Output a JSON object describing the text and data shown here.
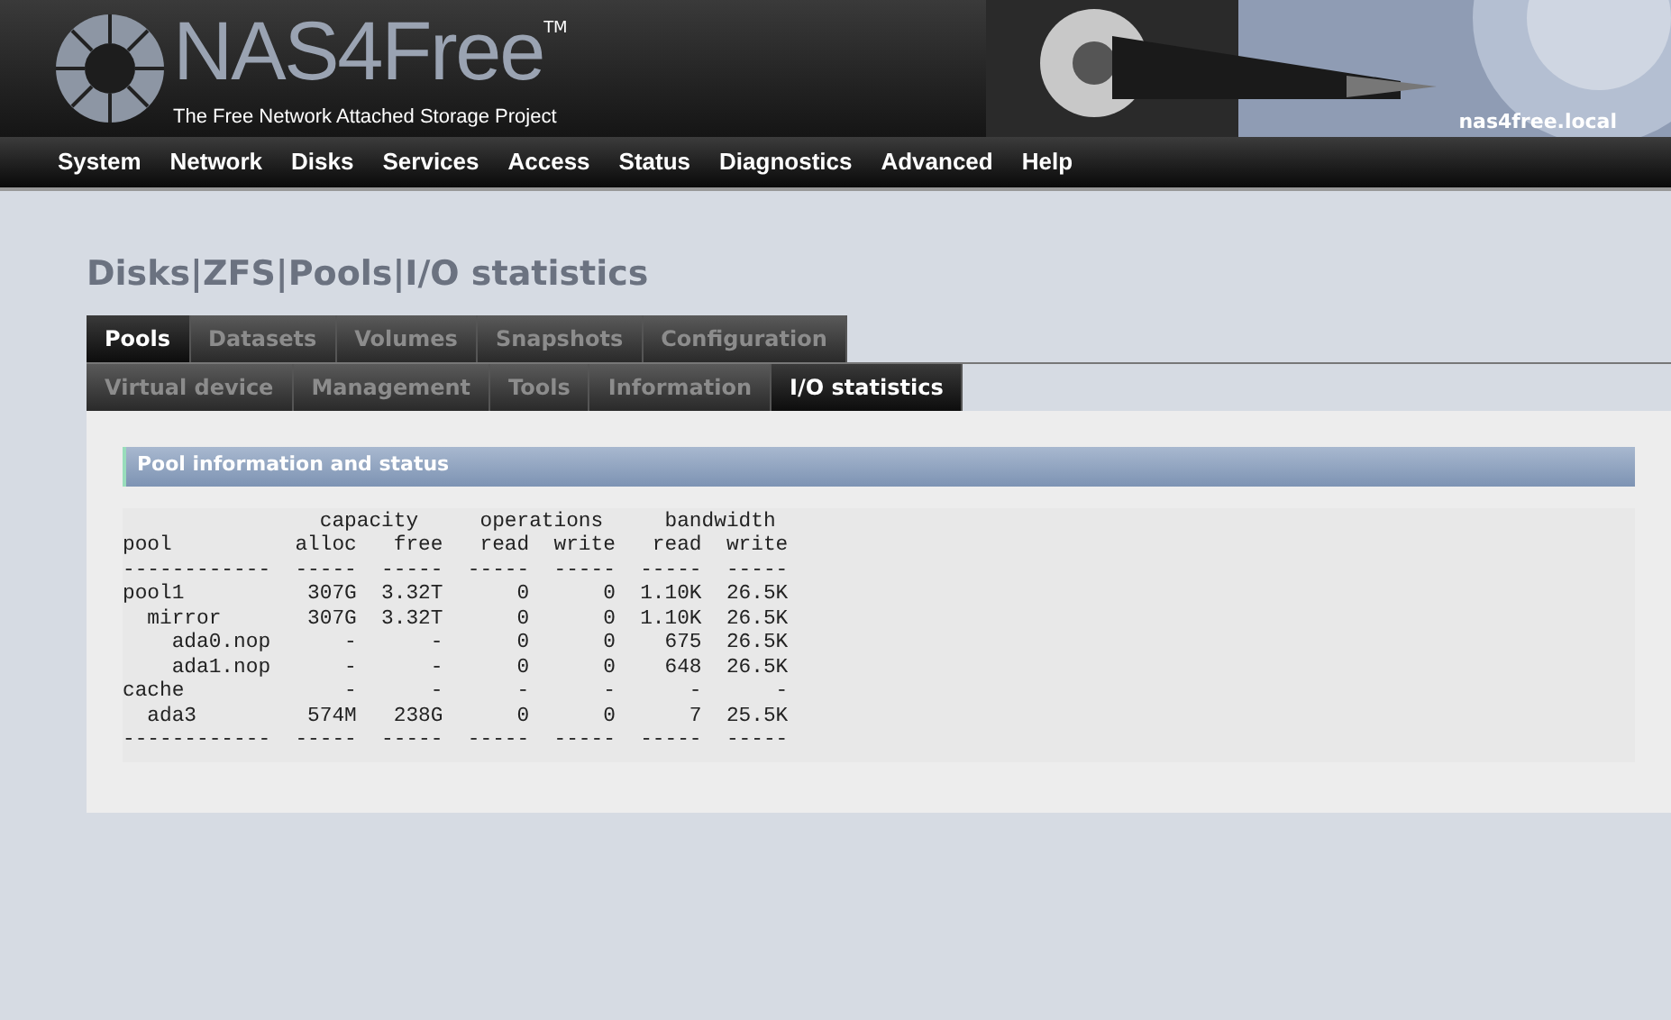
{
  "header": {
    "logo_text": "NAS4Free",
    "trademark": "TM",
    "tagline": "The Free Network Attached Storage Project",
    "hostname": "nas4free.local"
  },
  "nav": [
    "System",
    "Network",
    "Disks",
    "Services",
    "Access",
    "Status",
    "Diagnostics",
    "Advanced",
    "Help"
  ],
  "breadcrumb": "Disks|ZFS|Pools|I/O statistics",
  "tabs_row_1": [
    {
      "label": "Pools",
      "selected": true
    },
    {
      "label": "Datasets",
      "selected": false
    },
    {
      "label": "Volumes",
      "selected": false
    },
    {
      "label": "Snapshots",
      "selected": false
    },
    {
      "label": "Configuration",
      "selected": false
    }
  ],
  "tabs_row_2": [
    {
      "label": "Virtual device",
      "selected": false
    },
    {
      "label": "Management",
      "selected": false
    },
    {
      "label": "Tools",
      "selected": false
    },
    {
      "label": "Information",
      "selected": false
    },
    {
      "label": "I/O statistics",
      "selected": true
    }
  ],
  "section_title": "Pool information and status",
  "iostat_lines": [
    "                capacity     operations     bandwidth",
    "pool          alloc   free   read  write   read  write",
    "------------  -----  -----  -----  -----  -----  -----",
    "pool1          307G  3.32T      0      0  1.10K  26.5K",
    "  mirror       307G  3.32T      0      0  1.10K  26.5K",
    "    ada0.nop      -      -      0      0    675  26.5K",
    "    ada1.nop      -      -      0      0    648  26.5K",
    "cache             -      -      -      -      -      -",
    "  ada3         574M   238G      0      0      7  25.5K",
    "------------  -----  -----  -----  -----  -----  -----"
  ]
}
